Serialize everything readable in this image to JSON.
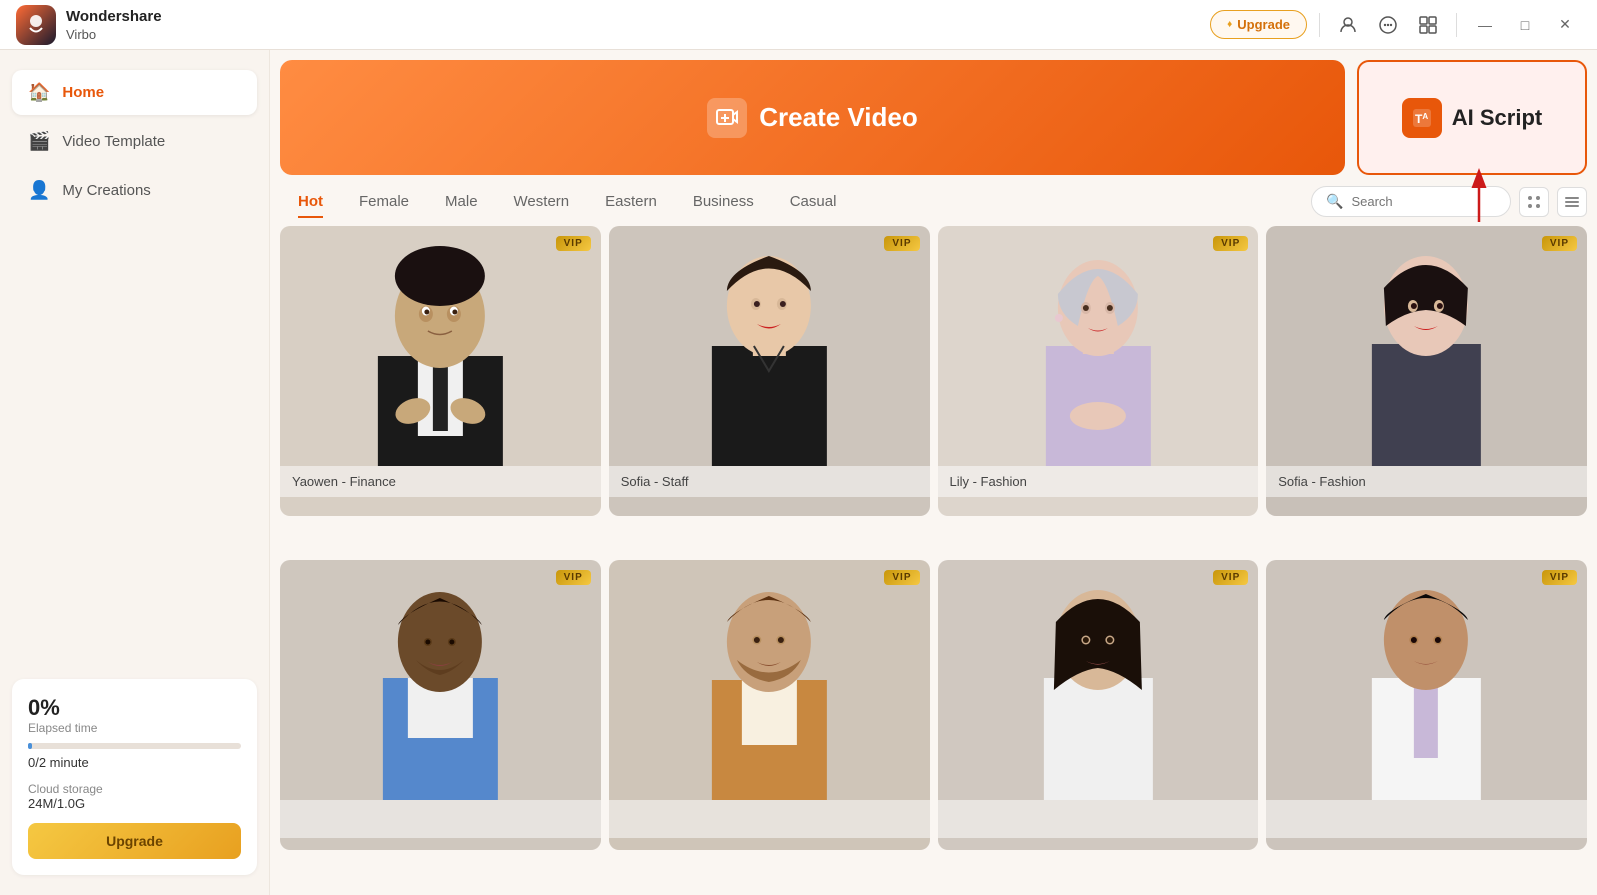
{
  "app": {
    "name": "Wondershare",
    "subname": "Virbo"
  },
  "titlebar": {
    "upgrade_label": "Upgrade",
    "minimize_label": "—",
    "maximize_label": "□",
    "close_label": "✕"
  },
  "sidebar": {
    "items": [
      {
        "id": "home",
        "label": "Home",
        "icon": "🏠",
        "active": true
      },
      {
        "id": "video-template",
        "label": "Video Template",
        "icon": "🎬",
        "active": false
      },
      {
        "id": "my-creations",
        "label": "My Creations",
        "icon": "👤",
        "active": false
      }
    ],
    "usage": {
      "percent": "0%",
      "elapsed_label": "Elapsed time",
      "time_value": "0/2 minute",
      "storage_label": "Cloud storage",
      "storage_value": "24M/1.0G",
      "upgrade_label": "Upgrade"
    }
  },
  "main": {
    "create_video_label": "Create Video",
    "ai_script_label": "AI Script"
  },
  "filters": {
    "tabs": [
      {
        "id": "hot",
        "label": "Hot",
        "active": true
      },
      {
        "id": "female",
        "label": "Female",
        "active": false
      },
      {
        "id": "male",
        "label": "Male",
        "active": false
      },
      {
        "id": "western",
        "label": "Western",
        "active": false
      },
      {
        "id": "eastern",
        "label": "Eastern",
        "active": false
      },
      {
        "id": "business",
        "label": "Business",
        "active": false
      },
      {
        "id": "casual",
        "label": "Casual",
        "active": false
      }
    ],
    "search_placeholder": "Search"
  },
  "avatars": [
    {
      "id": 1,
      "name": "Yaowen - Finance",
      "vip": true,
      "bg": "#d8cfc4",
      "skin": "#c8a87a",
      "suit": "#1a1a1a"
    },
    {
      "id": 2,
      "name": "Sofia - Staff",
      "vip": true,
      "bg": "#cdc5bc",
      "skin": "#e8c8a8",
      "suit": "#1a1a1a"
    },
    {
      "id": 3,
      "name": "Lily - Fashion",
      "vip": true,
      "bg": "#ddd5cc",
      "skin": "#e8c8b8",
      "suit": "#c8b8d8"
    },
    {
      "id": 4,
      "name": "Sofia - Fashion",
      "vip": true,
      "bg": "#c8c0b8",
      "skin": "#e8c8b8",
      "suit": "#404050"
    },
    {
      "id": 5,
      "name": "",
      "vip": true,
      "bg": "#cfc7be",
      "skin": "#6b4a2a",
      "suit": "#5588cc"
    },
    {
      "id": 6,
      "name": "",
      "vip": true,
      "bg": "#cfc5b8",
      "skin": "#c8a07a",
      "suit": "#c88840"
    },
    {
      "id": 7,
      "name": "",
      "vip": true,
      "bg": "#d0c8c0",
      "skin": "#d8b898",
      "suit": "#f0f0f0"
    },
    {
      "id": 8,
      "name": "",
      "vip": true,
      "bg": "#ccc4bc",
      "skin": "#c0906a",
      "suit": "#c8b8d8"
    }
  ]
}
